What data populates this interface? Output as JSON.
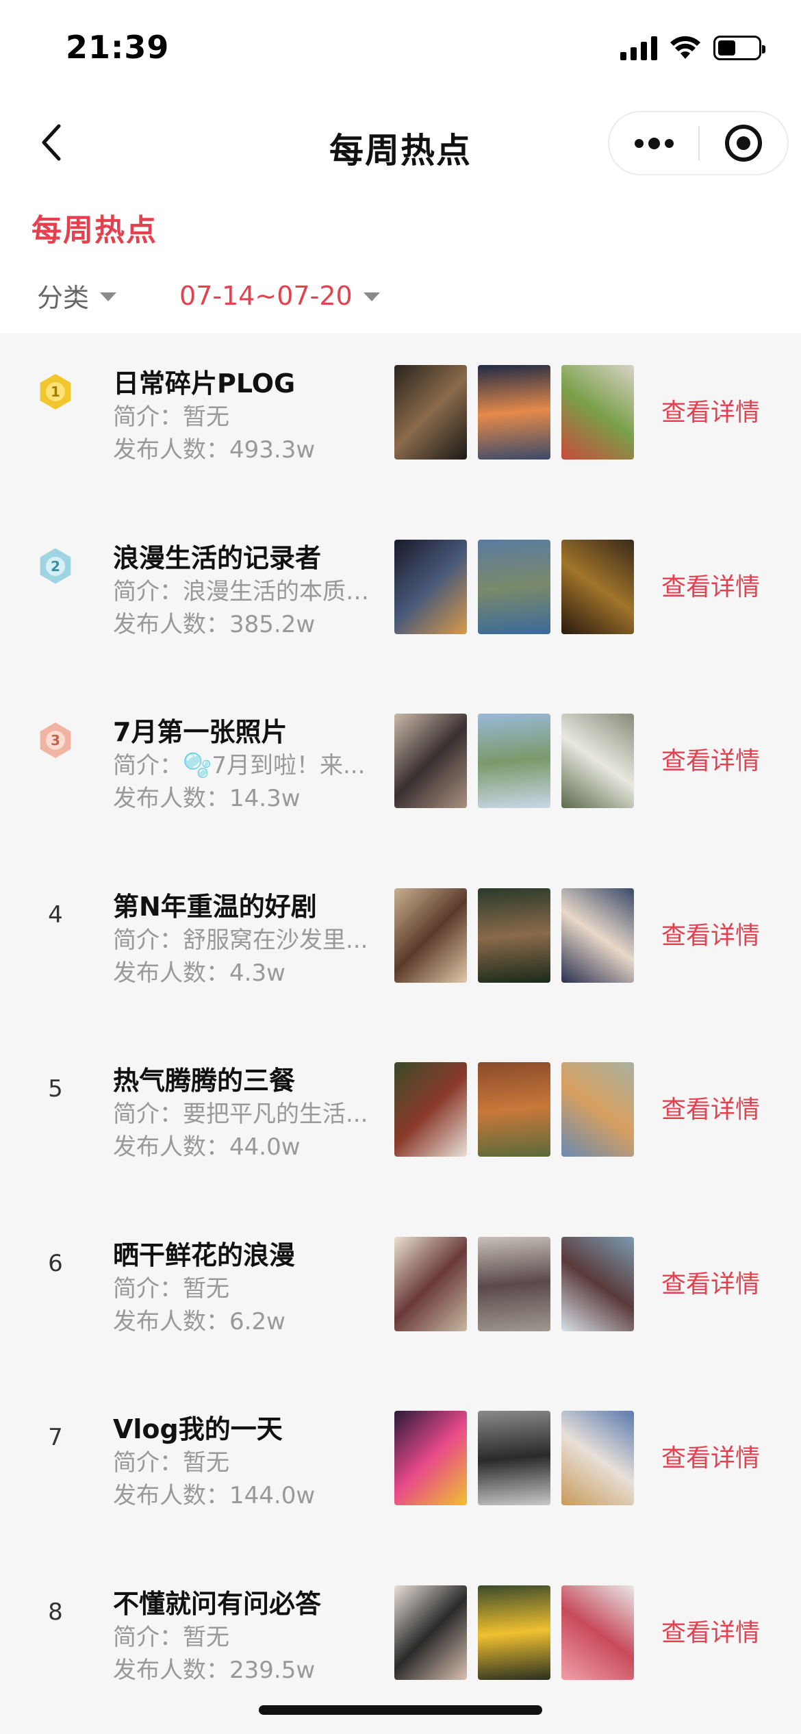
{
  "status_bar": {
    "time": "21:39",
    "battery_level": 0.45
  },
  "nav": {
    "title": "每周热点"
  },
  "header": {
    "section_title": "每周热点",
    "filters": {
      "category_label": "分类",
      "week_label": "07-14~07-20"
    }
  },
  "items": [
    {
      "rank": "1",
      "badge": "gold",
      "title": "日常碎片PLOG",
      "desc": "简介：暂无",
      "count": "发布人数：493.3w",
      "link": "查看详情",
      "thumb_colors": [
        [
          "#2a2520",
          "#8a6a4a",
          "#1c1a18"
        ],
        [
          "#1e2a46",
          "#e58a4a",
          "#3a4a6a"
        ],
        [
          "#d8d2c4",
          "#7aa04a",
          "#c84a3a"
        ]
      ]
    },
    {
      "rank": "2",
      "badge": "silver",
      "title": "浪漫生活的记录者",
      "desc": "简介：浪漫生活的本质是...",
      "count": "发布人数：385.2w",
      "link": "查看详情",
      "thumb_colors": [
        [
          "#1a1a2a",
          "#4a5a7a",
          "#d89a4a"
        ],
        [
          "#5a7aa0",
          "#7a8a6a",
          "#3a6a9a"
        ],
        [
          "#3a2a1a",
          "#a0742a",
          "#2a1a10"
        ]
      ]
    },
    {
      "rank": "3",
      "badge": "bronze",
      "title": "7月第一张照片",
      "desc": "简介：🫧7月到啦！来...",
      "count": "发布人数：14.3w",
      "link": "查看详情",
      "thumb_colors": [
        [
          "#c8b8a8",
          "#3a3030",
          "#a89080"
        ],
        [
          "#9ab8d8",
          "#7a9a6a",
          "#c8d8e8"
        ],
        [
          "#8a8a7a",
          "#e8e8e0",
          "#5a6a4a"
        ]
      ]
    },
    {
      "rank": "4",
      "badge": "",
      "title": "第N年重温的好剧",
      "desc": "简介：舒服窝在沙发里...",
      "count": "发布人数：4.3w",
      "link": "查看详情",
      "thumb_colors": [
        [
          "#c8b090",
          "#5a3a2a",
          "#e0c8a8"
        ],
        [
          "#2a3a2a",
          "#8a6a4a",
          "#1a2a1a"
        ],
        [
          "#3a4a6a",
          "#e8d8c8",
          "#2a3050"
        ]
      ]
    },
    {
      "rank": "5",
      "badge": "",
      "title": "热气腾腾的三餐",
      "desc": "简介：要把平凡的生活...",
      "count": "发布人数：44.0w",
      "link": "查看详情",
      "thumb_colors": [
        [
          "#3a4a2a",
          "#8a3a2a",
          "#e8e0d8"
        ],
        [
          "#8a4a2a",
          "#c8783a",
          "#5a6a3a"
        ],
        [
          "#a8b0a0",
          "#d8a060",
          "#6a8ab0"
        ]
      ]
    },
    {
      "rank": "6",
      "badge": "",
      "title": "晒干鲜花的浪漫",
      "desc": "简介：暂无",
      "count": "发布人数：6.2w",
      "link": "查看详情",
      "thumb_colors": [
        [
          "#e8e0d0",
          "#6a3a3a",
          "#c8b8a0"
        ],
        [
          "#c8c0b8",
          "#5a4a4a",
          "#a09890"
        ],
        [
          "#7a9ab0",
          "#5a3a3a",
          "#d8e0e8"
        ]
      ]
    },
    {
      "rank": "7",
      "badge": "",
      "title": "Vlog我的一天",
      "desc": "简介：暂无",
      "count": "发布人数：144.0w",
      "link": "查看详情",
      "thumb_colors": [
        [
          "#2a1a3a",
          "#e84a8a",
          "#f0c030"
        ],
        [
          "#8a8a8a",
          "#2a2a2a",
          "#c8c8c8"
        ],
        [
          "#5a7ab0",
          "#e8e0d8",
          "#c89a5a"
        ]
      ]
    },
    {
      "rank": "8",
      "badge": "",
      "title": "不懂就问有问必答",
      "desc": "简介：暂无",
      "count": "发布人数：239.5w",
      "link": "查看详情",
      "thumb_colors": [
        [
          "#e8e0d8",
          "#2a2a2a",
          "#d8c0b0"
        ],
        [
          "#3a4a2a",
          "#f0c030",
          "#2a3020"
        ],
        [
          "#e8e8e8",
          "#c84a5a",
          "#f0a0a8"
        ]
      ]
    }
  ],
  "icons": {
    "back": "chevron-left-icon",
    "more": "more-dots-icon",
    "close": "target-ring-icon",
    "caret": "caret-down-icon"
  }
}
